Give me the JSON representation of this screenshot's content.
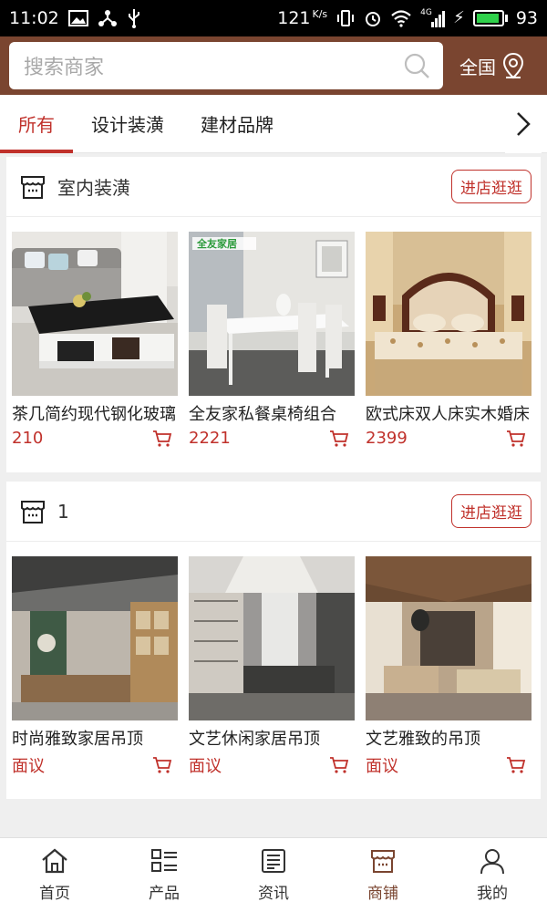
{
  "status_bar": {
    "time": "11:02",
    "speed": "121",
    "speed_unit": "K/s",
    "network": "4G",
    "battery": "93",
    "battery_level": 0.93
  },
  "header": {
    "search_placeholder": "搜索商家",
    "region_label": "全国"
  },
  "tabs": [
    {
      "label": "所有",
      "active": true
    },
    {
      "label": "设计装潢",
      "active": false
    },
    {
      "label": "建材品牌",
      "active": false
    }
  ],
  "shops": [
    {
      "name": "室内装潢",
      "enter_label": "进店逛逛",
      "products": [
        {
          "name": "茶几简约现代钢化玻璃",
          "price": "210"
        },
        {
          "name": "全友家私餐桌椅组合",
          "price": "2221",
          "image_text": "全友家居"
        },
        {
          "name": "欧式床双人床实木婚床",
          "price": "2399"
        }
      ]
    },
    {
      "name": "1",
      "enter_label": "进店逛逛",
      "products": [
        {
          "name": "时尚雅致家居吊顶",
          "price": "面议"
        },
        {
          "name": "文艺休闲家居吊顶",
          "price": "面议"
        },
        {
          "name": "文艺雅致的吊顶",
          "price": "面议"
        }
      ]
    }
  ],
  "bottom_nav": [
    {
      "label": "首页",
      "icon": "home-icon"
    },
    {
      "label": "产品",
      "icon": "product-list-icon"
    },
    {
      "label": "资讯",
      "icon": "news-icon"
    },
    {
      "label": "商铺",
      "icon": "shop-icon",
      "active": true
    },
    {
      "label": "我的",
      "icon": "user-icon"
    }
  ],
  "colors": {
    "brand": "#7a4530",
    "accent": "#c0312b"
  }
}
